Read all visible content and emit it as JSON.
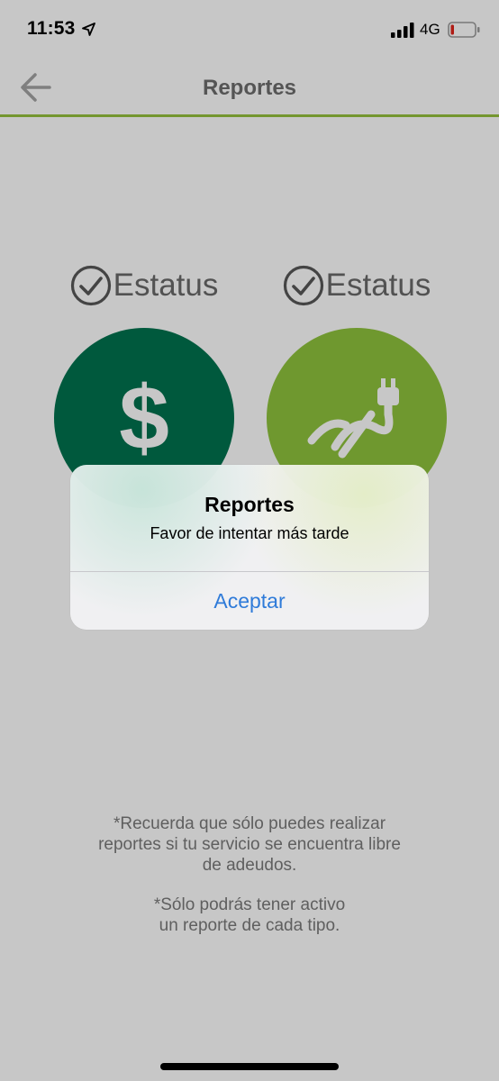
{
  "status_bar": {
    "time": "11:53",
    "network": "4G",
    "icons": [
      "location-arrow-icon",
      "signal-icon",
      "battery-icon"
    ]
  },
  "nav": {
    "title": "Reportes",
    "back_icon": "arrow-left-icon"
  },
  "reports": [
    {
      "status_label": "Estatus",
      "icon": "dollar-icon",
      "color": "#00734f"
    },
    {
      "status_label": "Estatus",
      "icon": "plug-icon",
      "color": "#8fc33d"
    }
  ],
  "payment_symbol": "$",
  "notes": {
    "line1": [
      "*Recuerda que sólo puedes realizar",
      "reportes si tu servicio se encuentra libre",
      "de adeudos."
    ],
    "line2": [
      "*Sólo podrás tener activo",
      "un reporte de cada tipo."
    ]
  },
  "alert": {
    "title": "Reportes",
    "message": "Favor de intentar más tarde",
    "button": "Aceptar"
  },
  "colors": {
    "accent_green": "#95c13d",
    "dark_green": "#00734f",
    "link_blue": "#2f7bd9"
  }
}
